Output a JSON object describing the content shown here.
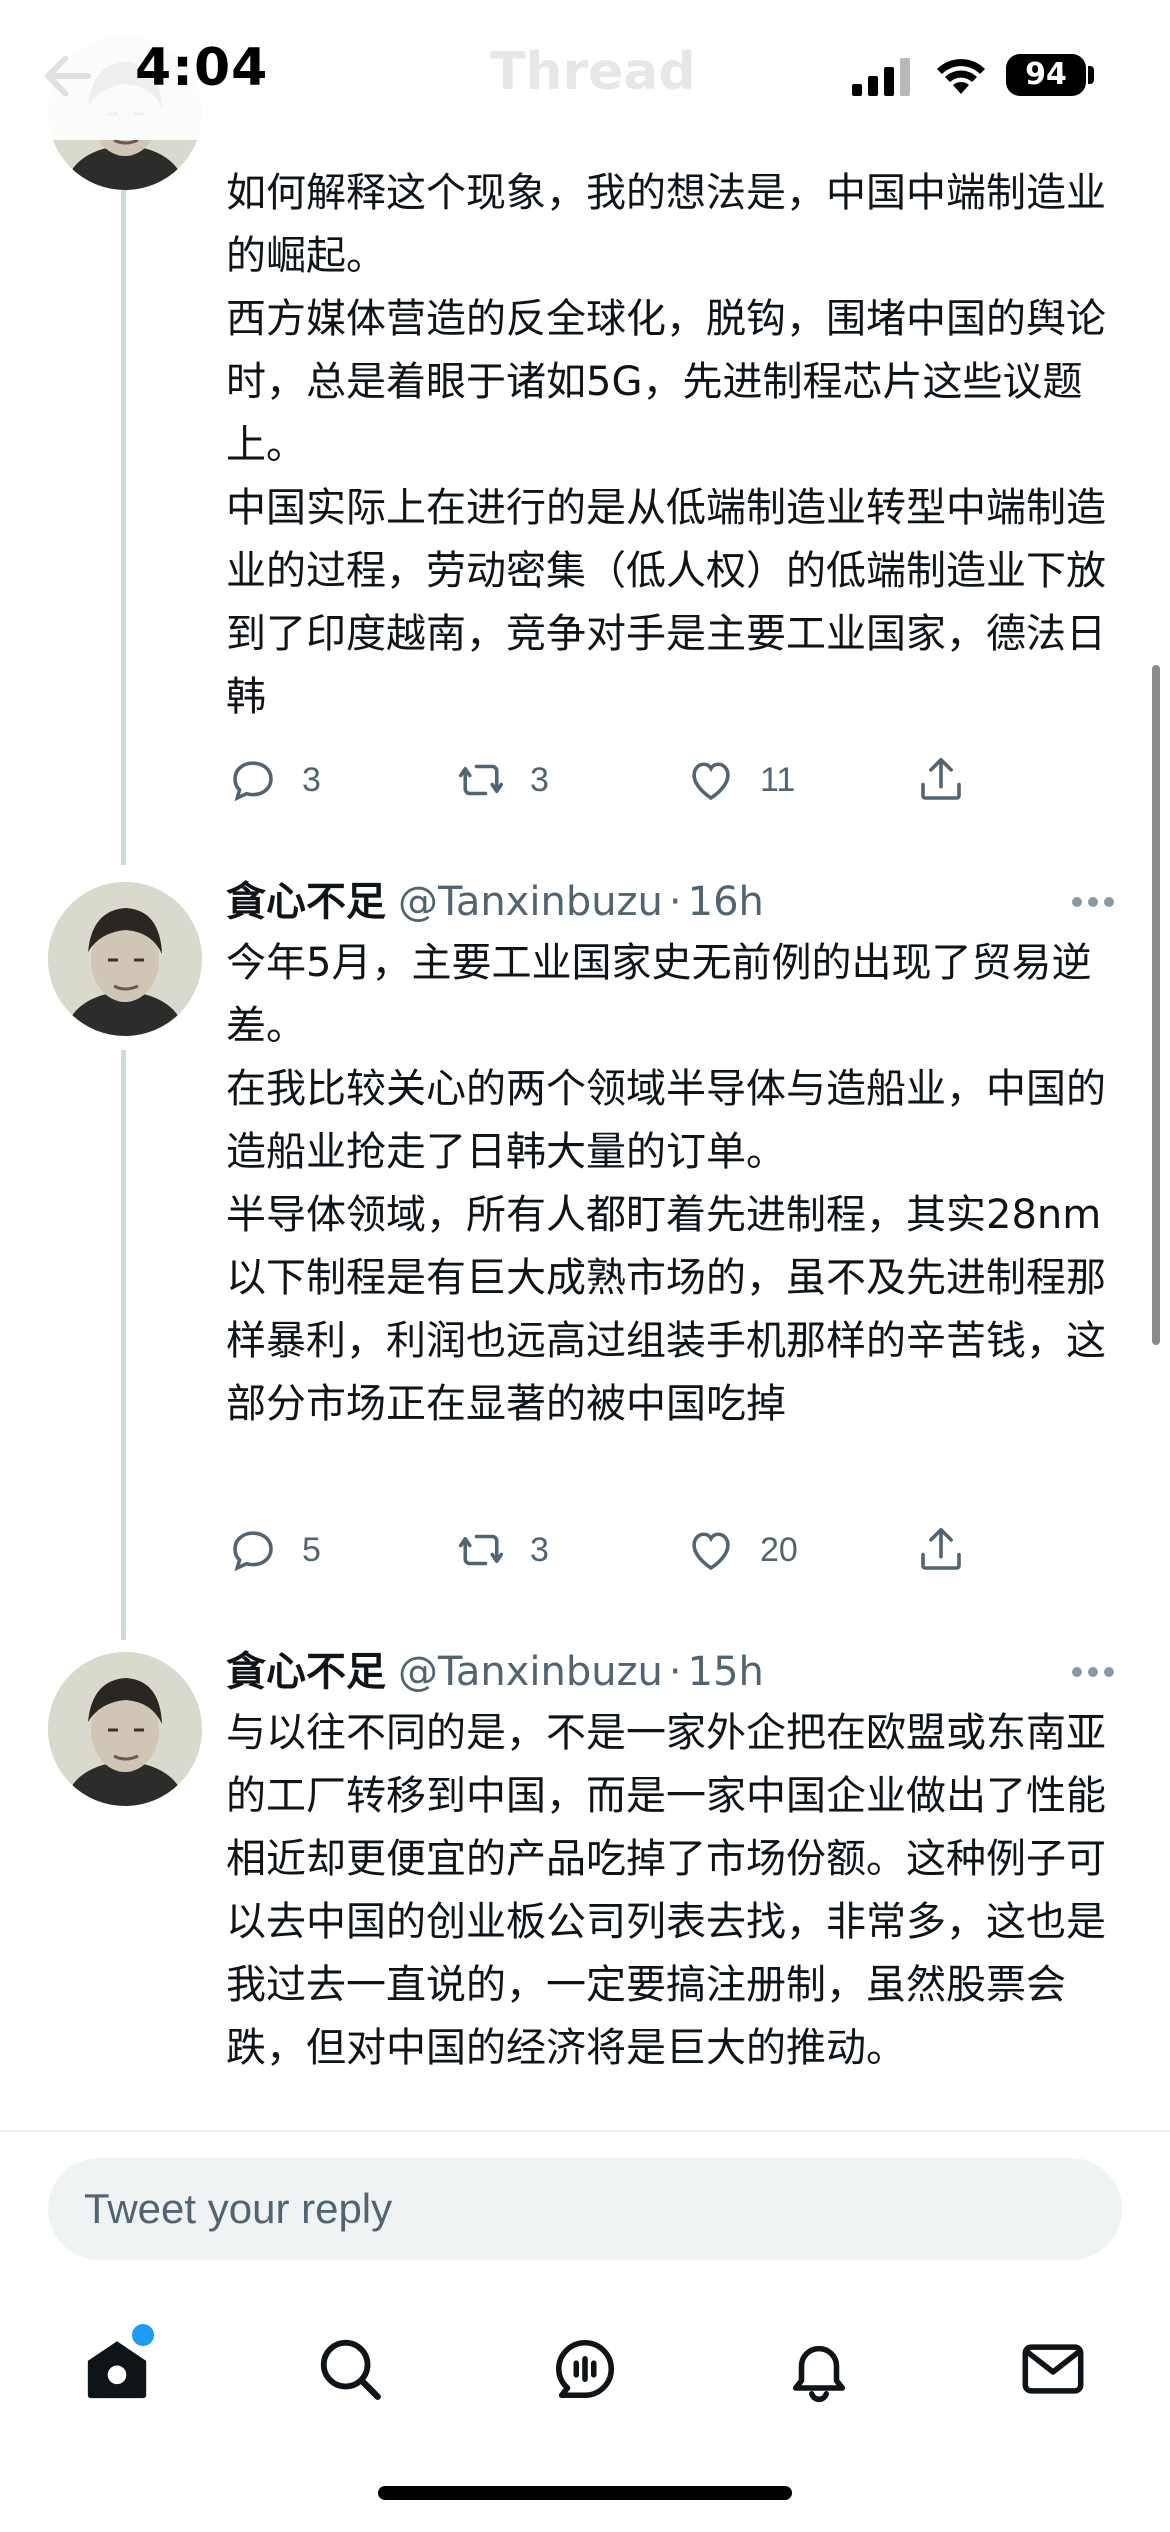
{
  "status_bar": {
    "time": "4:04",
    "battery": "94",
    "nav_title": "Thread"
  },
  "tweets": [
    {
      "name": "",
      "handle": "",
      "time": "",
      "paragraphs": [
        "如何解释这个现象，我的想法是，中国中端制造业的崛起。",
        "西方媒体营造的反全球化，脱钩，围堵中国的舆论时，总是着眼于诸如5G，先进制程芯片这些议题上。",
        "中国实际上在进行的是从低端制造业转型中端制造业的过程，劳动密集（低人权）的低端制造业下放到了印度越南，竞争对手是主要工业国家，德法日韩"
      ],
      "replies": "3",
      "retweets": "3",
      "likes": "11"
    },
    {
      "name": "貪心不足",
      "handle": "@Tanxinbuzu",
      "time": "16h",
      "paragraphs": [
        "今年5月，主要工业国家史无前例的出现了贸易逆差。",
        "在我比较关心的两个领域半导体与造船业，中国的造船业抢走了日韩大量的订单。",
        "半导体领域，所有人都盯着先进制程，其实28nm以下制程是有巨大成熟市场的，虽不及先进制程那样暴利，利润也远高过组装手机那样的辛苦钱，这部分市场正在显著的被中国吃掉"
      ],
      "replies": "5",
      "retweets": "3",
      "likes": "20"
    },
    {
      "name": "貪心不足",
      "handle": "@Tanxinbuzu",
      "time": "15h",
      "paragraphs": [
        "与以往不同的是，不是一家外企把在欧盟或东南亚的工厂转移到中国，而是一家中国企业做出了性能相近却更便宜的产品吃掉了市场份额。这种例子可以去中国的创业板公司列表去找，非常多，这也是我过去一直说的，一定要搞注册制，虽然股票会跌，但对中国的经济将是巨大的推动。"
      ]
    }
  ],
  "reply_bar": {
    "placeholder": "Tweet your reply"
  },
  "tabs": [
    "home-icon",
    "search-icon",
    "spaces-icon",
    "notifications-icon",
    "messages-icon"
  ],
  "colors": {
    "accent": "#1d9bf0",
    "secondary_text": "#536471",
    "thread_line": "#cfd9de"
  }
}
